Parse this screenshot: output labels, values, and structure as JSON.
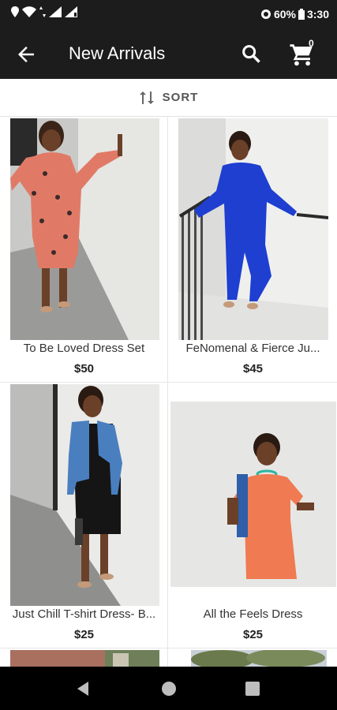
{
  "status": {
    "battery": "60%",
    "time": "3:30"
  },
  "app_bar": {
    "title": "New Arrivals",
    "cart_count": "0"
  },
  "sort": {
    "label": "SORT"
  },
  "products": [
    {
      "name": "To Be Loved Dress Set",
      "price": "$50"
    },
    {
      "name": "FeNomenal & Fierce Ju...",
      "price": "$45"
    },
    {
      "name": "Just Chill T-shirt Dress- B...",
      "price": "$25"
    },
    {
      "name": "All the Feels Dress",
      "price": "$25"
    }
  ],
  "icons": {
    "back": "arrow-left-icon",
    "search": "search-icon",
    "cart": "cart-icon",
    "sort": "sort-icon"
  },
  "colors": {
    "app_bar": "#1c1c1c",
    "price": "#222222"
  }
}
